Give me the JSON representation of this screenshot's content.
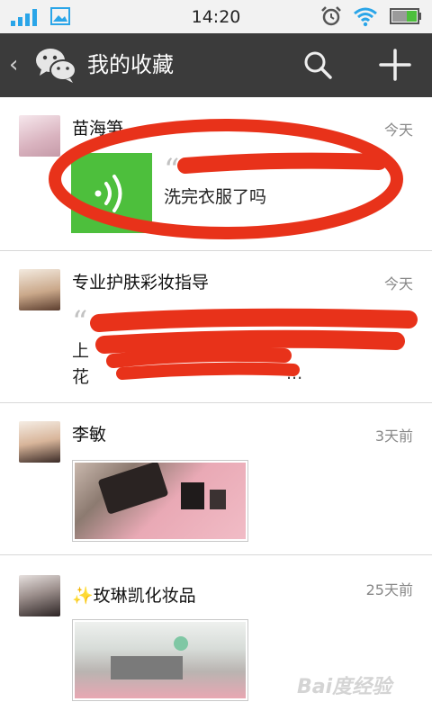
{
  "statusbar": {
    "time": "14:20"
  },
  "header": {
    "back_glyph": "‹",
    "title": "我的收藏"
  },
  "icons": {
    "signal": "signal-bars-icon",
    "gallery": "gallery-icon",
    "alarm": "alarm-clock-icon",
    "wifi": "wifi-icon",
    "battery": "battery-icon",
    "logo": "wechat-logo-icon",
    "search": "search-icon",
    "add": "plus-icon",
    "voice": "voice-message-icon",
    "sparkle": "sparkle-emoji-icon"
  },
  "colors": {
    "accent_green": "#4dbf3c",
    "header_bg": "#3b3b3b",
    "annotation_red": "#e8321a"
  },
  "favorites": [
    {
      "name": "苗海笋",
      "time": "今天",
      "type": "voice",
      "text": "洗完衣服了吗"
    },
    {
      "name": "专业护肤彩妆指导",
      "time": "今天",
      "type": "text",
      "text_line1": "上",
      "text_line2": "花",
      "ellipsis": "..."
    },
    {
      "name": "李敏",
      "time": "3天前",
      "type": "image"
    },
    {
      "name": "✨玫琳凯化妆品",
      "time": "25天前",
      "type": "image"
    }
  ],
  "watermark": {
    "text": "Bai度经验"
  }
}
